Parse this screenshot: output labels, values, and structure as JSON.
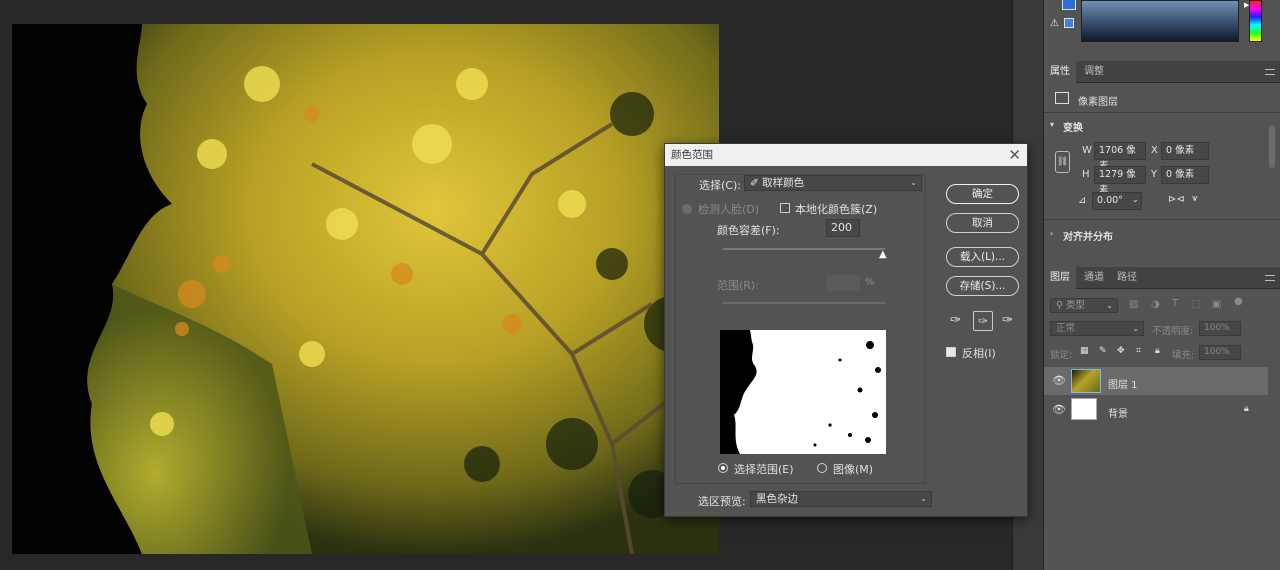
{
  "panel": {
    "tabs_properties": [
      "属性",
      "调整"
    ],
    "layer_kind": "像素图层",
    "transform_header": "变换",
    "w_label": "W",
    "w_value": "1706 像素",
    "x_label": "X",
    "x_value": "0 像素",
    "h_label": "H",
    "h_value": "1279 像素",
    "y_label": "Y",
    "y_value": "0 像素",
    "angle_value": "0.00°",
    "align_header": "对齐并分布",
    "tabs_layers": [
      "图层",
      "通道",
      "路径"
    ],
    "filter_kind": "类型",
    "blend_mode": "正常",
    "opacity_label": "不透明度:",
    "opacity_value": "100%",
    "lock_label": "锁定:",
    "fill_label": "填充:",
    "fill_value": "100%",
    "layers": [
      {
        "name": "图层 1",
        "selected": true
      },
      {
        "name": "背景",
        "selected": false
      }
    ]
  },
  "dialog": {
    "title": "颜色范围",
    "select_label": "选择(C):",
    "select_value": "取样颜色",
    "detect_faces": "检测人脸(D)",
    "localized": "本地化颜色簇(Z)",
    "fuzziness_label": "颜色容差(F):",
    "fuzziness_value": "200",
    "fuzziness_fraction": 1.0,
    "range_label": "范围(R):",
    "range_unit": "%",
    "radio_selection": "选择范围(E)",
    "radio_image": "图像(M)",
    "preview_label": "选区预览:",
    "preview_value": "黑色杂边",
    "ok": "确定",
    "cancel": "取消",
    "load": "载入(L)...",
    "save": "存储(S)...",
    "invert": "反相(I)",
    "invert_checked": true
  },
  "colors": {
    "accent": "#ffffff",
    "panel_bg": "#535353",
    "canvas_bg": "#282828"
  }
}
